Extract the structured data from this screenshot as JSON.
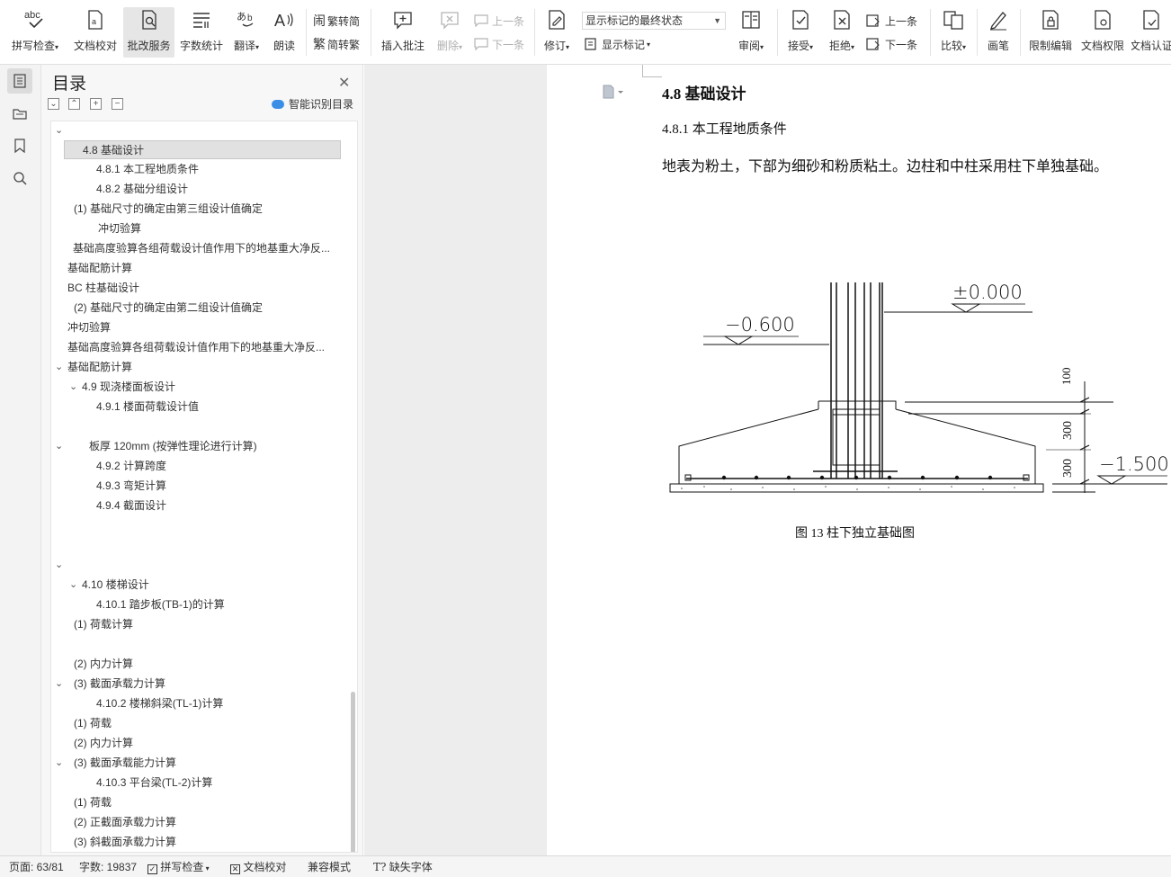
{
  "ribbon": {
    "spell_check": "拼写检查",
    "doc_proof": "文档校对",
    "revise_service": "批改服务",
    "word_count": "字数统计",
    "translate": "翻译",
    "read_aloud": "朗读",
    "trad_to_simp": "繁转简",
    "simp_to_trad": "简转繁",
    "insert_comment": "插入批注",
    "delete": "删除",
    "prev_comment": "上一条",
    "next_comment": "下一条",
    "track_changes": "修订",
    "markup_dropdown": "显示标记的最终状态",
    "show_markup": "显示标记",
    "review": "审阅",
    "accept": "接受",
    "reject": "拒绝",
    "prev_change": "上一条",
    "next_change": "下一条",
    "compare": "比较",
    "pen": "画笔",
    "restrict_edit": "限制编辑",
    "doc_permission": "文档权限",
    "doc_cert": "文档认证"
  },
  "toc": {
    "title": "目录",
    "smart": "智能识别目录",
    "items": [
      {
        "text": "4.8  基础设计"
      },
      {
        "text": "4.8.1  本工程地质条件"
      },
      {
        "text": "4.8.2  基础分组设计"
      },
      {
        "text": "(1)  基础尺寸的确定由第三组设计值确定"
      },
      {
        "text": "冲切验算"
      },
      {
        "text": "基础高度验算各组荷载设计值作用下的地基重大净反..."
      },
      {
        "text": "基础配筋计算"
      },
      {
        "text": "BC 柱基础设计"
      },
      {
        "text": "(2)   基础尺寸的确定由第二组设计值确定"
      },
      {
        "text": "冲切验算"
      },
      {
        "text": "基础高度验算各组荷载设计值作用下的地基重大净反..."
      },
      {
        "text": "基础配筋计算"
      },
      {
        "text": "4.9  现浇楼面板设计"
      },
      {
        "text": "4.9.1 楼面荷载设计值"
      },
      {
        "text": "板厚  120mm  (按弹性理论进行计算)"
      },
      {
        "text": "4.9.2  计算跨度"
      },
      {
        "text": "4.9.3 弯矩计算"
      },
      {
        "text": "4.9.4  截面设计"
      },
      {
        "text": "4.10   楼梯设计"
      },
      {
        "text": "4.10.1    踏步板(TB-1)的计算"
      },
      {
        "text": "(1)   荷载计算"
      },
      {
        "text": "(2)   内力计算"
      },
      {
        "text": "(3)  截面承载力计算"
      },
      {
        "text": "4.10.2    楼梯斜梁(TL-1)计算"
      },
      {
        "text": "(1)   荷载"
      },
      {
        "text": "(2)  内力计算"
      },
      {
        "text": "(3)     截面承载能力计算"
      },
      {
        "text": "4.10.3  平台梁(TL-2)计算"
      },
      {
        "text": "(1)     荷载"
      },
      {
        "text": "(2)  正截面承载力计算"
      },
      {
        "text": "(3)  斜截面承载力计算"
      }
    ]
  },
  "document": {
    "heading": "4.8  基础设计",
    "subheading": "4.8.1  本工程地质条件",
    "paragraph": "地表为粉土，下部为细砂和粉质粘土。边柱和中柱采用柱下单独基础。",
    "figure": {
      "caption": "图 13    柱下独立基础图",
      "elev_top": "±0.000",
      "elev_ground": "−0.600",
      "elev_bottom": "−1.500",
      "dim_100": "100",
      "dim_300a": "300",
      "dim_300b": "300"
    }
  },
  "status": {
    "page": "页面: 63/81",
    "words": "字数: 19837",
    "spell": "拼写检查",
    "proof": "文档校对",
    "compat": "兼容模式",
    "missing_font": "缺失字体"
  }
}
